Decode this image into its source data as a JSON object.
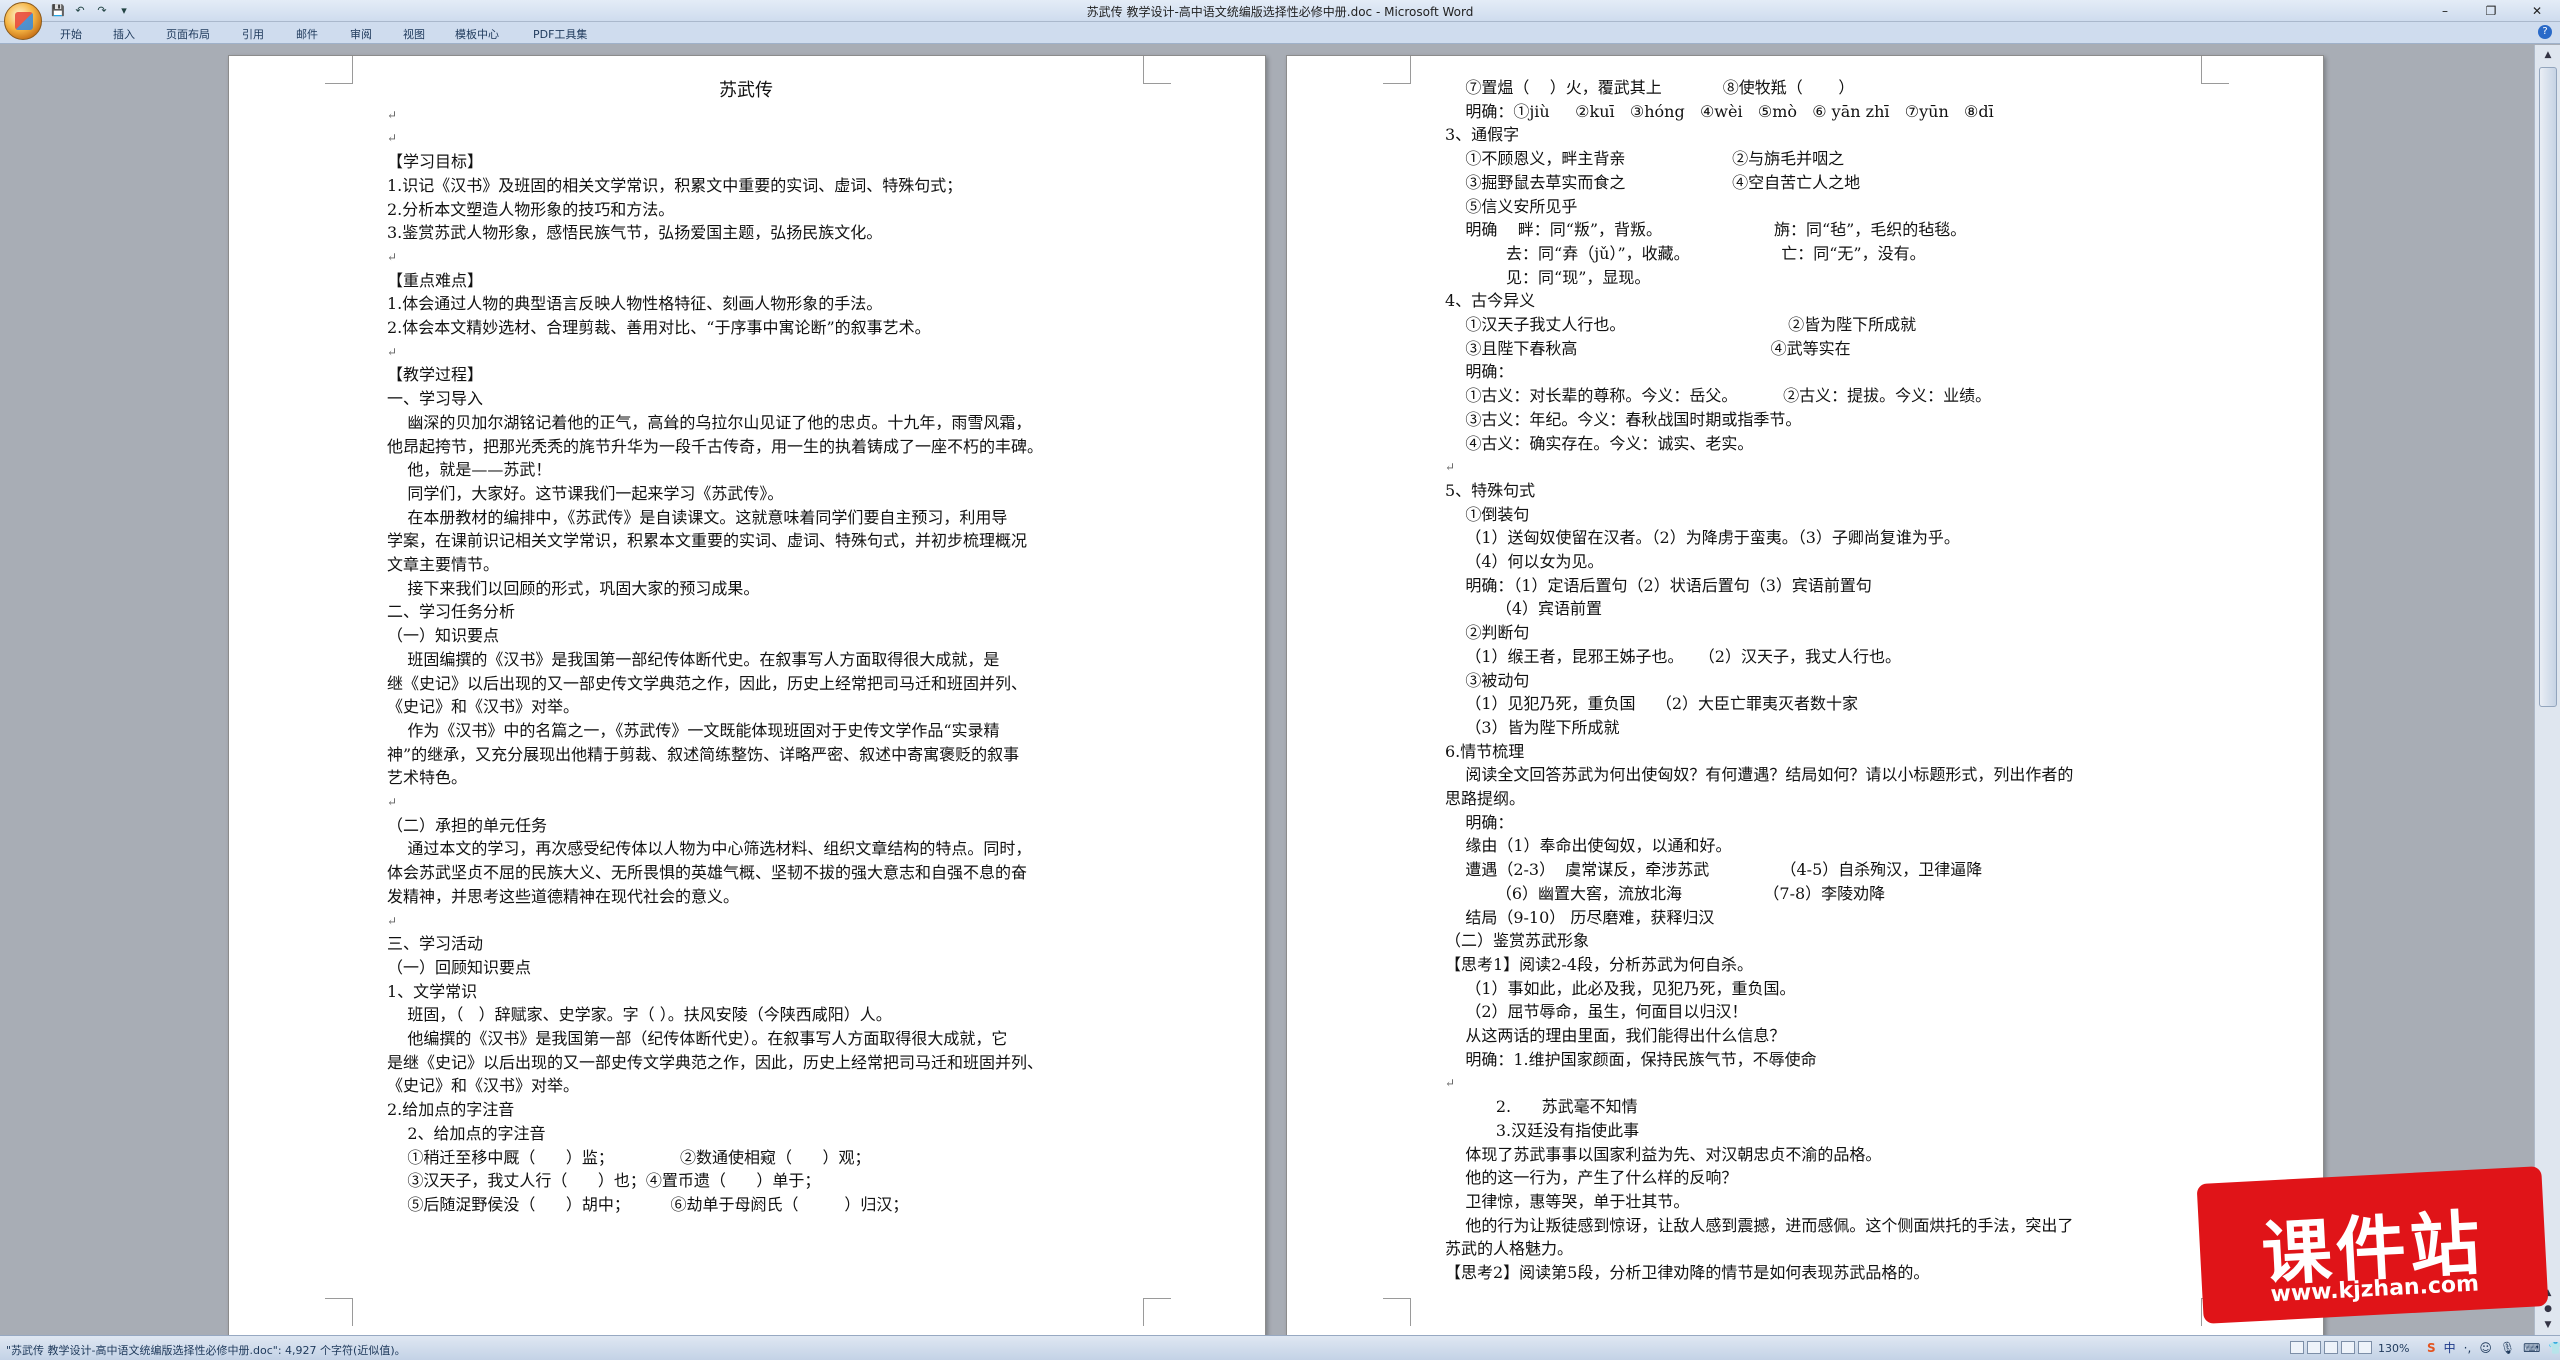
{
  "window": {
    "title": "苏武传 教学设计-高中语文统编版选择性必修中册.doc - Microsoft Word",
    "controls": [
      "–",
      "❐",
      "✕"
    ]
  },
  "quick_access": [
    "💾",
    "↶",
    "↷",
    "▾"
  ],
  "ribbon": {
    "tabs": [
      "开始",
      "插入",
      "页面布局",
      "引用",
      "邮件",
      "审阅",
      "视图",
      "模板中心",
      "PDF工具集"
    ]
  },
  "status": {
    "text": "\"苏武传 教学设计-高中语文统编版选择性必修中册.doc\": 4,927 个字符(近似值)。",
    "zoom": "130%",
    "ime": [
      "S",
      "中",
      "·,",
      "☺",
      "🎙",
      "⌨",
      "👕"
    ]
  },
  "watermark": {
    "name": "课件站",
    "url": "www.kjzhan.com"
  },
  "page1": {
    "lines": [
      "苏武传",
      "",
      "",
      "【学习目标】",
      "1.识记《汉书》及班固的相关文学常识，积累文中重要的实词、虚词、特殊句式；",
      "2.分析本文塑造人物形象的技巧和方法。",
      "3.鉴赏苏武人物形象，感悟民族气节，弘扬爱国主题，弘扬民族文化。",
      "",
      "【重点难点】",
      "1.体会通过人物的典型语言反映人物性格特征、刻画人物形象的手法。",
      "2.体会本文精妙选材、合理剪裁、善用对比、“于序事中寓论断”的叙事艺术。",
      "",
      "【教学过程】",
      "一、学习导入",
      "    幽深的贝加尔湖铭记着他的正气，高耸的乌拉尔山见证了他的忠贞。十九年，雨雪风霜，",
      "他昂起挎节，把那光秃秃的旄节升华为一段千古传奇，用一生的执着铸成了一座不朽的丰碑。",
      "    他，就是——苏武！",
      "    同学们，大家好。这节课我们一起来学习《苏武传》。",
      "    在本册教材的编排中，《苏武传》是自读课文。这就意味着同学们要自主预习，利用导",
      "学案，在课前识记相关文学常识，积累本文重要的实词、虚词、特殊句式，并初步梳理概况",
      "文章主要情节。",
      "    接下来我们以回顾的形式，巩固大家的预习成果。",
      "二、学习任务分析",
      "（一）知识要点",
      "    班固编撰的《汉书》是我国第一部纪传体断代史。在叙事写人方面取得很大成就，是",
      "继《史记》以后出现的又一部史传文学典范之作，因此，历史上经常把司马迁和班固并列、",
      "《史记》和《汉书》对举。",
      "    作为《汉书》中的名篇之一，《苏武传》一文既能体现班固对于史传文学作品“实录精",
      "神”的继承，又充分展现出他精于剪裁、叙述简练整饬、详略严密、叙述中寄寓褒贬的叙事",
      "艺术特色。",
      "",
      "（二）承担的单元任务",
      "    通过本文的学习，再次感受纪传体以人物为中心筛选材料、组织文章结构的特点。同时，",
      "体会苏武坚贞不屈的民族大义、无所畏惧的英雄气概、坚韧不拔的强大意志和自强不息的奋",
      "发精神，并思考这些道德精神在现代社会的意义。",
      "",
      "三、学习活动",
      "（一）回顾知识要点",
      "1、文学常识",
      "    班固，（   ）辞赋家、史学家。字（ ）。扶风安陵（今陕西咸阳）人。",
      "    他编撰的《汉书》是我国第一部（纪传体断代史）。在叙事写人方面取得很大成就，它",
      "是继《史记》以后出现的又一部史传文学典范之作，因此，历史上经常把司马迁和班固并列、",
      "《史记》和《汉书》对举。",
      "2.给加点的字注音",
      "    2、给加点的字注音",
      "    ①稍迁至移中厩（      ）监；             ②数通使相窥（      ）观；",
      "    ③汉天子，我丈人行（      ）也；④置币遗（      ）单于；",
      "    ⑤后随浞野侯没（      ）胡中；        ⑥劫单于母阏氏（         ）归汉；"
    ]
  },
  "page2": {
    "lines": [
      "    ⑦置煴（    ）火，覆武其上            ⑧使牧羝（       ）",
      "    明确：①jiù     ②kuī   ③hóng   ④wèi   ⑤mò   ⑥ yān zhī   ⑦yūn   ⑧dī",
      "3、通假字",
      "    ①不顾恩义，畔主背亲                     ②与旃毛并咽之",
      "    ③掘野鼠去草实而食之                     ④空自苦亡人之地",
      "    ⑤信义安所见乎",
      "    明确    畔：同“叛”，背叛。                      旃：同“毡”，毛织的毡毯。",
      "            去：同“弆（jǔ）”，收藏。                  亡：同“无”，没有。",
      "            见：同“现”，显现。",
      "4、古今异义",
      "    ①汉天子我丈人行也。                                ②皆为陛下所成就",
      "    ③且陛下春秋高                                      ④武等实在",
      "    明确：",
      "    ①古义：对长辈的尊称。今义：岳父。         ②古义：提拔。今义：业绩。",
      "    ③古义：年纪。今义：春秋战国时期或指季节。",
      "    ④古义：确实存在。今义：诚实、老实。",
      "",
      "5、特殊句式",
      "    ①倒装句",
      "    （1）送匈奴使留在汉者。（2）为降虏于蛮夷。（3）子卿尚复谁为乎。",
      "    （4）何以女为见。",
      "    明确：（1）定语后置句（2）状语后置句（3）宾语前置句",
      "          （4）宾语前置",
      "    ②判断句",
      "    （1）缑王者，昆邪王姊子也。   （2）汉天子，我丈人行也。",
      "    ③被动句",
      "    （1）见犯乃死，重负国    （2）大臣亡罪夷灭者数十家",
      "    （3）皆为陛下所成就",
      "6.情节梳理",
      "    阅读全文回答苏武为何出使匈奴？有何遭遇？结局如何？请以小标题形式，列出作者的",
      "思路提纲。",
      "    明确：",
      "    缘由（1）奉命出使匈奴，以通和好。",
      "    遭遇（2-3）  虞常谋反，牵涉苏武              （4-5）自杀殉汉，卫律逼降",
      "          （6）幽置大窖，流放北海                （7-8）李陵劝降",
      "    结局（9-10） 历尽磨难，获释归汉",
      "（二）鉴赏苏武形象",
      "【思考1】阅读2-4段，分析苏武为何自杀。",
      "    （1）事如此，此必及我，见犯乃死，重负国。",
      "    （2）屈节辱命，虽生，何面目以归汉！",
      "    从这两话的理由里面，我们能得出什么信息？",
      "    明确：1.维护国家颜面，保持民族气节，不辱使命",
      "",
      "          2.      苏武毫不知情",
      "          3.汉廷没有指使此事",
      "    体现了苏武事事以国家利益为先、对汉朝忠贞不渝的品格。",
      "    他的这一行为，产生了什么样的反响？",
      "    卫律惊，惠等哭，单于壮其节。",
      "    他的行为让叛徒感到惊讶，让敌人感到震撼，进而感佩。这个侧面烘托的手法，突出了",
      "苏武的人格魅力。",
      "【思考2】阅读第5段，分析卫律劝降的情节是如何表现苏武品格的。"
    ]
  }
}
